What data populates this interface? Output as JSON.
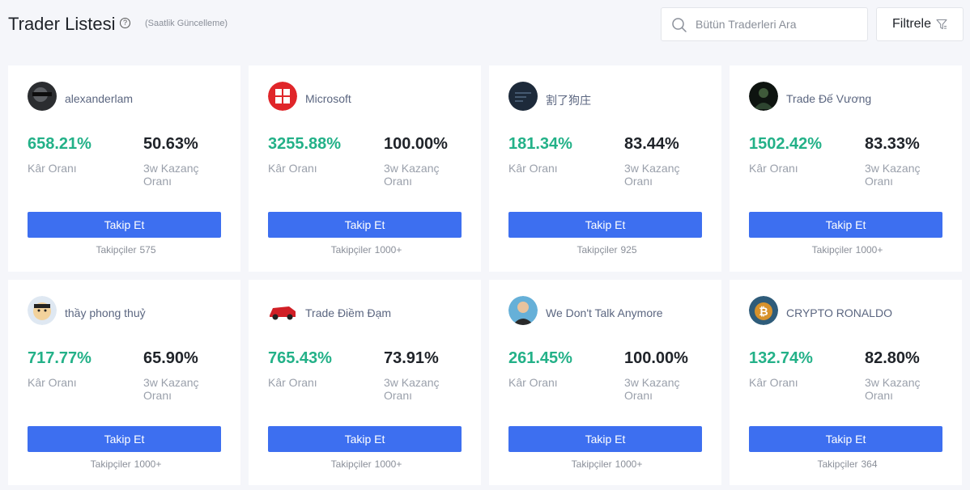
{
  "header": {
    "title": "Trader Listesi",
    "subtitle": "(Saatlik Güncelleme)",
    "search_placeholder": "Bütün Traderleri Ara",
    "filter_label": "Filtrele"
  },
  "labels": {
    "profit_label": "Kâr Oranı",
    "winrate_label": "3w Kazanç Oranı",
    "follow_button": "Takip Et",
    "followers_prefix": "Takipçiler"
  },
  "traders": [
    {
      "name": "alexanderlam",
      "profit": "658.21%",
      "winrate": "50.63%",
      "followers": "575",
      "avatar": "dark-photo-avatar"
    },
    {
      "name": "Microsoft",
      "profit": "3255.88%",
      "winrate": "100.00%",
      "followers": "1000+",
      "avatar": "microsoft-logo-avatar"
    },
    {
      "name": "割了狗庄",
      "profit": "181.34%",
      "winrate": "83.44%",
      "followers": "925",
      "avatar": "dark-screen-avatar"
    },
    {
      "name": "Trade Đế Vương",
      "profit": "1502.42%",
      "winrate": "83.33%",
      "followers": "1000+",
      "avatar": "dark-figure-avatar"
    },
    {
      "name": "thầy phong thuỷ",
      "profit": "717.77%",
      "winrate": "65.90%",
      "followers": "1000+",
      "avatar": "cartoon-avatar"
    },
    {
      "name": "Trade Điềm Đạm",
      "profit": "765.43%",
      "winrate": "73.91%",
      "followers": "1000+",
      "avatar": "red-car-avatar"
    },
    {
      "name": "We Don't Talk Anymore",
      "profit": "261.45%",
      "winrate": "100.00%",
      "followers": "1000+",
      "avatar": "person-photo-avatar"
    },
    {
      "name": "CRYPTO RONALDO",
      "profit": "132.74%",
      "winrate": "82.80%",
      "followers": "364",
      "avatar": "bitcoin-avatar"
    }
  ],
  "colors": {
    "profit": "#23b188",
    "button": "#3d6ff0",
    "name": "#5b6680"
  }
}
